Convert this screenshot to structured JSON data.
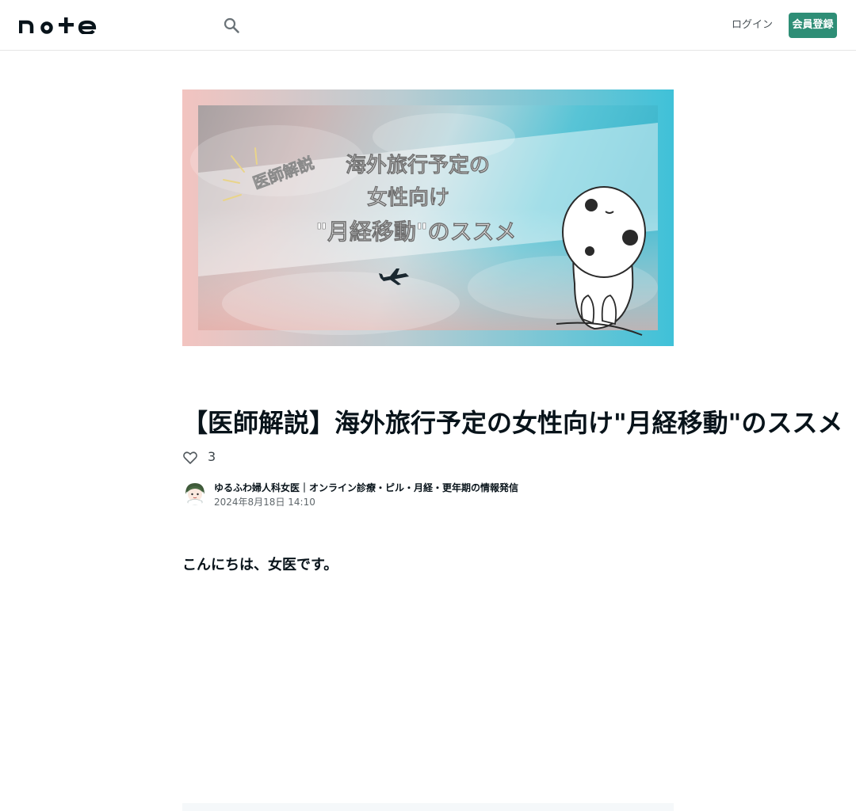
{
  "header": {
    "logo_text": "note",
    "search_icon": "search-icon",
    "login_label": "ログイン",
    "signup_label": "会員登録"
  },
  "hero": {
    "badge": "医師解説",
    "line1": "海外旅行予定の",
    "line2": "女性向け",
    "line3": "\"月経移動\"のススメ"
  },
  "article": {
    "title": "【医師解説】海外旅行予定の女性向け\"月経移動\"のススメ",
    "like_icon": "heart-icon",
    "like_count": "3",
    "author": "ゆるふわ婦人科女医｜オンライン診療・ピル・月経・更年期の情報発信",
    "date": "2024年8月18日 14:10",
    "lead": "こんにちは、女医です。"
  },
  "colors": {
    "accent": "#2e8e76",
    "text": "#08131a"
  }
}
